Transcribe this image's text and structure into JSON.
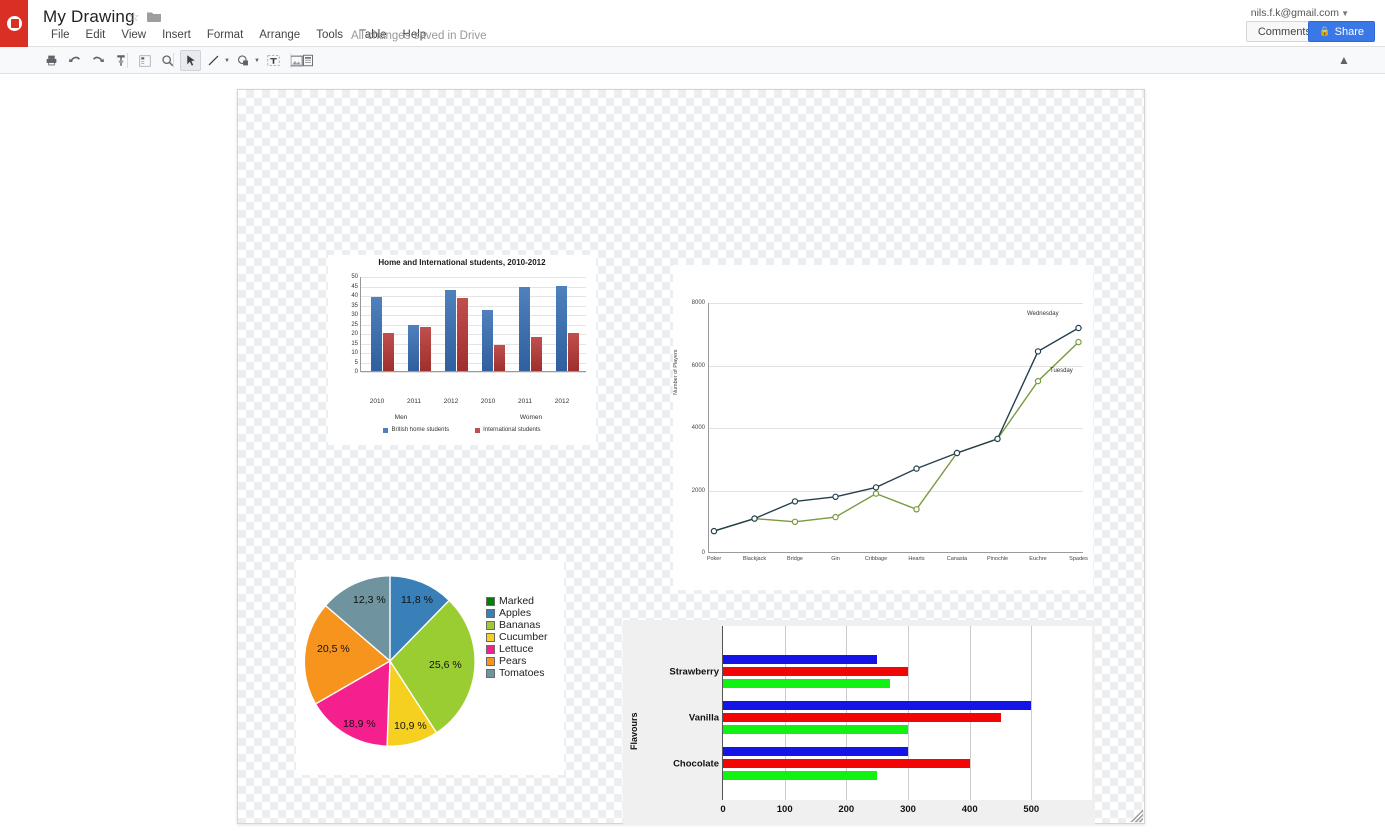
{
  "app": {
    "logo_icon": "drawings-app-icon",
    "doc_title": "My Drawing",
    "star_icon": "star-outline-icon",
    "folder_icon": "folder-icon",
    "save_status": "All changes saved in Drive",
    "account_email": "nils.f.k@gmail.com",
    "account_caret_icon": "chevron-down-icon",
    "comments_label": "Comments",
    "share_label": "Share",
    "share_lock_icon": "lock-icon"
  },
  "menubar": {
    "items": [
      {
        "label": "File"
      },
      {
        "label": "Edit"
      },
      {
        "label": "View"
      },
      {
        "label": "Insert"
      },
      {
        "label": "Format"
      },
      {
        "label": "Arrange"
      },
      {
        "label": "Tools"
      },
      {
        "label": "Table"
      },
      {
        "label": "Help"
      }
    ]
  },
  "toolbar": {
    "buttons": [
      {
        "name": "print-icon",
        "selected": false
      },
      {
        "name": "undo-icon",
        "selected": false
      },
      {
        "name": "redo-icon",
        "selected": false
      },
      {
        "name": "paint-format-icon",
        "selected": false
      },
      {
        "name": "zoom-to-fit-icon",
        "selected": false
      },
      {
        "name": "zoom-icon",
        "selected": false
      },
      {
        "name": "select-cursor-icon",
        "selected": true
      },
      {
        "name": "line-icon",
        "selected": false
      },
      {
        "name": "shape-icon",
        "selected": false
      },
      {
        "name": "text-box-icon",
        "selected": false
      },
      {
        "name": "image-icon",
        "selected": false
      },
      {
        "name": "align-icon",
        "selected": false
      }
    ],
    "collapse_icon": "chevron-up-icon"
  },
  "canvas": {
    "resize_handle_icon": "resize-handle-icon"
  },
  "chart_data": [
    {
      "id": "bar-chart-students",
      "type": "bar",
      "title": "Home and International students, 2010-2012",
      "xlabel": "",
      "ylabel": "",
      "ylim": [
        0,
        50
      ],
      "yticks": [
        0,
        5,
        10,
        15,
        20,
        25,
        30,
        35,
        40,
        45,
        50
      ],
      "categories": [
        "2010",
        "2011",
        "2012",
        "2010",
        "2011",
        "2012"
      ],
      "group_labels": [
        "Men",
        "Women"
      ],
      "grid": true,
      "legend_position": "bottom",
      "series": [
        {
          "name": "British home students",
          "color": "#4f81bd",
          "values": [
            39,
            24,
            42.5,
            32,
            44,
            45
          ]
        },
        {
          "name": "International students",
          "color": "#c0504d",
          "values": [
            20,
            23,
            38.5,
            13.5,
            18,
            20
          ]
        }
      ]
    },
    {
      "id": "line-chart-players",
      "type": "line",
      "title": "",
      "xlabel": "",
      "ylabel": "Number of Players",
      "ylim": [
        0,
        8000
      ],
      "yticks": [
        0,
        2000,
        4000,
        6000,
        8000
      ],
      "grid": true,
      "legend_position": "inline",
      "x": [
        "Poker",
        "Blackjack",
        "Bridge",
        "Gin",
        "Cribbage",
        "Hearts",
        "Canasta",
        "Pinochle",
        "Euchre",
        "Spades"
      ],
      "series": [
        {
          "name": "Wednesday",
          "color": "#25404f",
          "values": [
            700,
            1100,
            1650,
            1800,
            2100,
            2700,
            3200,
            3650,
            6450,
            7200
          ]
        },
        {
          "name": "Tuesday",
          "color": "#7a9a3e",
          "values": [
            700,
            1100,
            1000,
            1150,
            1900,
            1400,
            3200,
            3650,
            5500,
            6750
          ]
        }
      ]
    },
    {
      "id": "pie-chart-produce",
      "type": "pie",
      "title": "",
      "legend_position": "right",
      "labels": [
        "Apples",
        "Bananas",
        "Cucumber",
        "Lettuce",
        "Pears",
        "Tomatoes"
      ],
      "values": [
        11.8,
        25.6,
        10.9,
        18.9,
        20.5,
        12.3
      ],
      "value_labels": [
        "11,8 %",
        "25,6 %",
        "10,9 %",
        "18,9 %",
        "20,5 %",
        "12,3 %"
      ],
      "colors": [
        "#3a80b8",
        "#9acd32",
        "#f5d020",
        "#f51f8e",
        "#f7941e",
        "#6f94a0"
      ],
      "legend_entries": [
        {
          "label": "Marked",
          "color": "#008000"
        },
        {
          "label": "Apples",
          "color": "#3a80b8"
        },
        {
          "label": "Bananas",
          "color": "#9acd32"
        },
        {
          "label": "Cucumber",
          "color": "#f5d020"
        },
        {
          "label": "Lettuce",
          "color": "#f51f8e"
        },
        {
          "label": "Pears",
          "color": "#f7941e"
        },
        {
          "label": "Tomatoes",
          "color": "#6f94a0"
        }
      ]
    },
    {
      "id": "hbar-chart-flavours",
      "type": "bar",
      "orientation": "horizontal",
      "title": "",
      "ylabel": "Flavours",
      "xlabel": "",
      "xlim": [
        0,
        600
      ],
      "xticks": [
        0,
        100,
        200,
        300,
        400,
        500
      ],
      "grid": true,
      "categories": [
        "Strawberry",
        "Vanilla",
        "Chocolate"
      ],
      "series": [
        {
          "name": "blue-series",
          "color": "#1414e6",
          "values": [
            250,
            500,
            300
          ]
        },
        {
          "name": "red-series",
          "color": "#f20505",
          "values": [
            300,
            450,
            400
          ]
        },
        {
          "name": "green-series",
          "color": "#12f212",
          "values": [
            270,
            300,
            250
          ]
        }
      ]
    }
  ]
}
